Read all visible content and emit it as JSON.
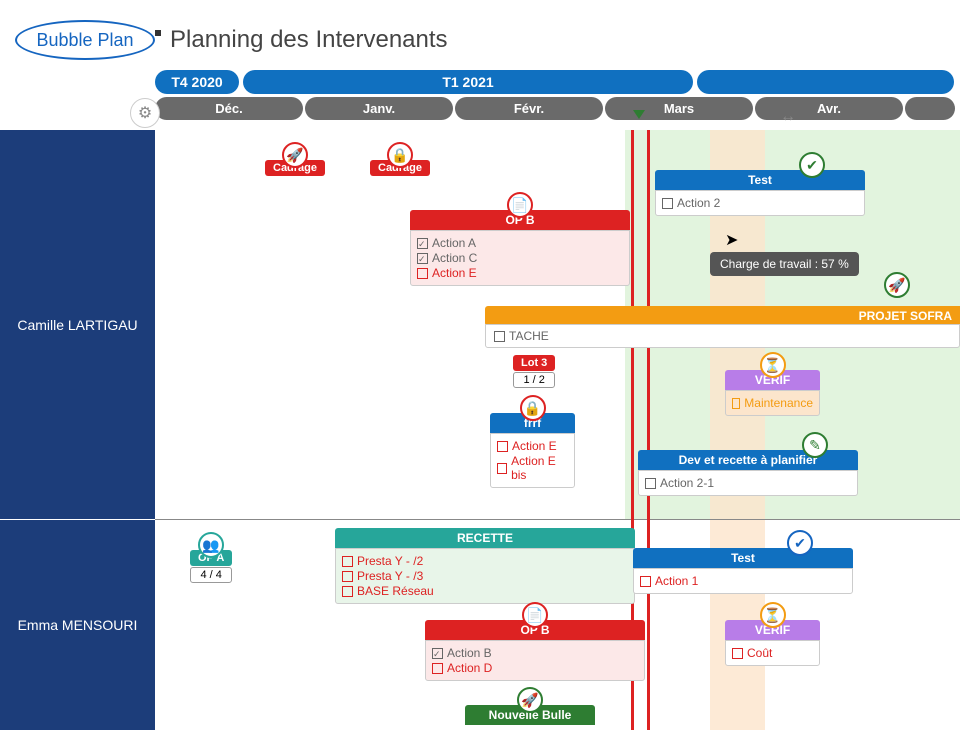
{
  "title": "Planning des Intervenants",
  "logo": "Bubble Plan",
  "quarters": [
    "T4 2020",
    "T1 2021",
    ""
  ],
  "months": [
    "Déc.",
    "Janv.",
    "Févr.",
    "Mars",
    "Avr.",
    ""
  ],
  "people": [
    "Camille LARTIGAU",
    "Emma MENSOURI"
  ],
  "tooltip": "Charge de travail : 57 %",
  "badges": {
    "cadrage1": "Cadrage",
    "cadrage2": "Cadrage",
    "lot3": {
      "title": "Lot 3",
      "count": "1 / 2"
    },
    "opa": {
      "title": "OP A",
      "count": "4 / 4"
    }
  },
  "cards": {
    "opb1": {
      "title": "OP B",
      "actions": [
        {
          "label": "Action A",
          "done": true,
          "cls": "gray"
        },
        {
          "label": "Action C",
          "done": true,
          "cls": "gray"
        },
        {
          "label": "Action E",
          "done": false,
          "cls": "red"
        }
      ]
    },
    "test1": {
      "title": "Test",
      "actions": [
        {
          "label": "Action 2",
          "done": false,
          "cls": "gray"
        }
      ]
    },
    "frrf": {
      "title": "frrf",
      "actions": [
        {
          "label": "Action E",
          "done": false,
          "cls": "red"
        },
        {
          "label": "Action E bis",
          "done": false,
          "cls": "red"
        }
      ]
    },
    "verif1": {
      "title": "VERIF",
      "actions": [
        {
          "label": "Maintenance",
          "done": false,
          "cls": "orange"
        }
      ]
    },
    "dev": {
      "title": "Dev et recette à planifier",
      "actions": [
        {
          "label": "Action 2-1",
          "done": false,
          "cls": "gray"
        }
      ]
    },
    "recette": {
      "title": "RECETTE",
      "actions": [
        {
          "label": "Presta Y - /2",
          "done": false,
          "cls": "red"
        },
        {
          "label": "Presta Y - /3",
          "done": false,
          "cls": "red"
        },
        {
          "label": "BASE Réseau",
          "done": false,
          "cls": "red"
        }
      ]
    },
    "test2": {
      "title": "Test",
      "actions": [
        {
          "label": "Action 1",
          "done": false,
          "cls": "red"
        }
      ]
    },
    "opb2": {
      "title": "OP B",
      "actions": [
        {
          "label": "Action B",
          "done": true,
          "cls": "gray"
        },
        {
          "label": "Action D",
          "done": false,
          "cls": "red"
        }
      ]
    },
    "verif2": {
      "title": "VERIF",
      "actions": [
        {
          "label": "Coût",
          "done": false,
          "cls": "red"
        }
      ]
    },
    "nouvelle": "Nouvelle Bulle"
  },
  "project": {
    "title": "PROJET SOFRA",
    "sub": "TACHE"
  }
}
